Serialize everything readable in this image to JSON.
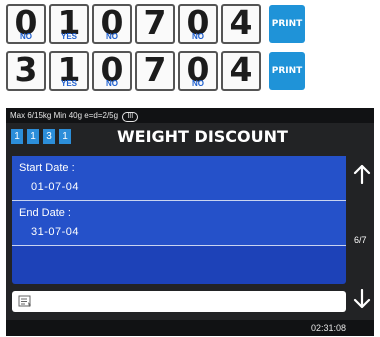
{
  "keypad": {
    "rows": [
      {
        "keys": [
          {
            "digit": "0",
            "sub": "NO"
          },
          {
            "digit": "1",
            "sub": "YES"
          },
          {
            "digit": "0",
            "sub": "NO"
          },
          {
            "digit": "7",
            "sub": ""
          },
          {
            "digit": "0",
            "sub": "NO"
          },
          {
            "digit": "4",
            "sub": ""
          }
        ],
        "print_label": "PRINT"
      },
      {
        "keys": [
          {
            "digit": "3",
            "sub": ""
          },
          {
            "digit": "1",
            "sub": "YES"
          },
          {
            "digit": "0",
            "sub": "NO"
          },
          {
            "digit": "7",
            "sub": ""
          },
          {
            "digit": "0",
            "sub": "NO"
          },
          {
            "digit": "4",
            "sub": ""
          }
        ],
        "print_label": "PRINT"
      }
    ]
  },
  "screen": {
    "header": {
      "spec": "Max 6/15kg Min 40g e=d=2/5g",
      "accuracy_class": "III"
    },
    "code_boxes": [
      "1",
      "1",
      "3",
      "1"
    ],
    "title": "WEIGHT DISCOUNT",
    "fields": [
      {
        "label": "Start Date :",
        "value": "01-07-04"
      },
      {
        "label": "End  Date :",
        "value": "31-07-04"
      }
    ],
    "page_indicator": "6/7",
    "input_icon": "note-icon",
    "clock": "02:31:08",
    "colors": {
      "panel": "#1d42b8",
      "field": "#2551c9",
      "code_box": "#2c8ed9",
      "print_button": "#1f93d8",
      "sub_label": "#1e5fcf"
    }
  }
}
